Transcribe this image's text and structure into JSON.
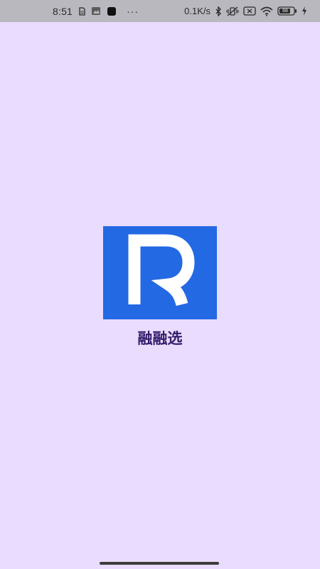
{
  "status_bar": {
    "time": "8:51",
    "more_indicator": "···",
    "network_speed": "0.1K/s",
    "icons": [
      "sim-card-icon",
      "image-notification-icon",
      "app-notification-icon",
      "bluetooth-icon",
      "vibrate-icon",
      "no-sim-icon",
      "wifi-icon",
      "battery-icon",
      "charging-icon"
    ],
    "battery_level": "68"
  },
  "splash": {
    "logo_letter": "R",
    "logo_color": "#2369e3",
    "app_name": "融融选",
    "app_name_color": "#341c6a",
    "background_color": "#e9dcff"
  }
}
